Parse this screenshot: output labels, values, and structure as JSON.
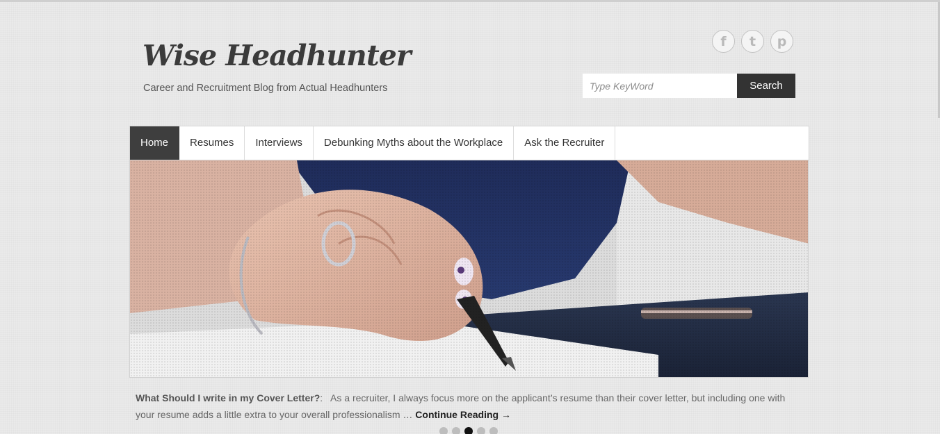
{
  "site": {
    "title": "Wise Headhunter",
    "tagline": "Career and Recruitment Blog from Actual Headhunters"
  },
  "social": [
    {
      "name": "facebook-icon",
      "glyph": "f"
    },
    {
      "name": "twitter-icon",
      "glyph": "t"
    },
    {
      "name": "pinterest-icon",
      "glyph": "p"
    }
  ],
  "search": {
    "placeholder": "Type KeyWord",
    "button_label": "Search"
  },
  "nav": {
    "items": [
      {
        "label": "Home",
        "active": true
      },
      {
        "label": "Resumes",
        "active": false
      },
      {
        "label": "Interviews",
        "active": false
      },
      {
        "label": "Debunking Myths about the Workplace",
        "active": false
      },
      {
        "label": "Ask the Recruiter",
        "active": false
      }
    ]
  },
  "featured": {
    "post_title": "What Should I write in my Cover Letter?",
    "separator": ":",
    "excerpt": "As a recruiter, I always focus more on the applicant’s resume than their cover letter, but including one with your resume adds a little extra to your overall professionalism …",
    "read_more": "Continue Reading →"
  },
  "slider": {
    "dot_count": 5,
    "active_dot": 2
  },
  "colors": {
    "background": "#eaeaea",
    "nav_active": "#3e3e3e",
    "search_button": "#333333"
  }
}
